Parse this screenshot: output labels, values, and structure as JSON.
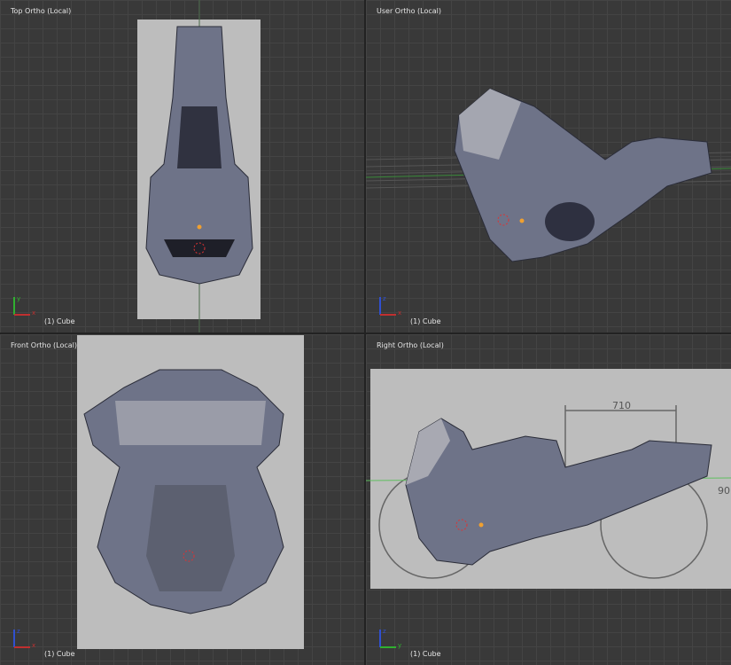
{
  "viewports": [
    {
      "title": "Top Ortho (Local)",
      "object": "(1) Cube"
    },
    {
      "title": "User Ortho (Local)",
      "object": "(1) Cube"
    },
    {
      "title": "Front Ortho (Local)",
      "object": "(1) Cube"
    },
    {
      "title": "Right Ortho (Local)",
      "object": "(1) Cube"
    }
  ],
  "axes": {
    "x": "x",
    "y": "y",
    "z": "z"
  },
  "reference": {
    "dimension_1": "710",
    "dimension_2": "90"
  },
  "colors": {
    "grid_bg": "#393939",
    "mesh": "#6e7388",
    "x_axis": "#c03030",
    "y_axis": "#30b030",
    "z_axis": "#3050d0"
  }
}
